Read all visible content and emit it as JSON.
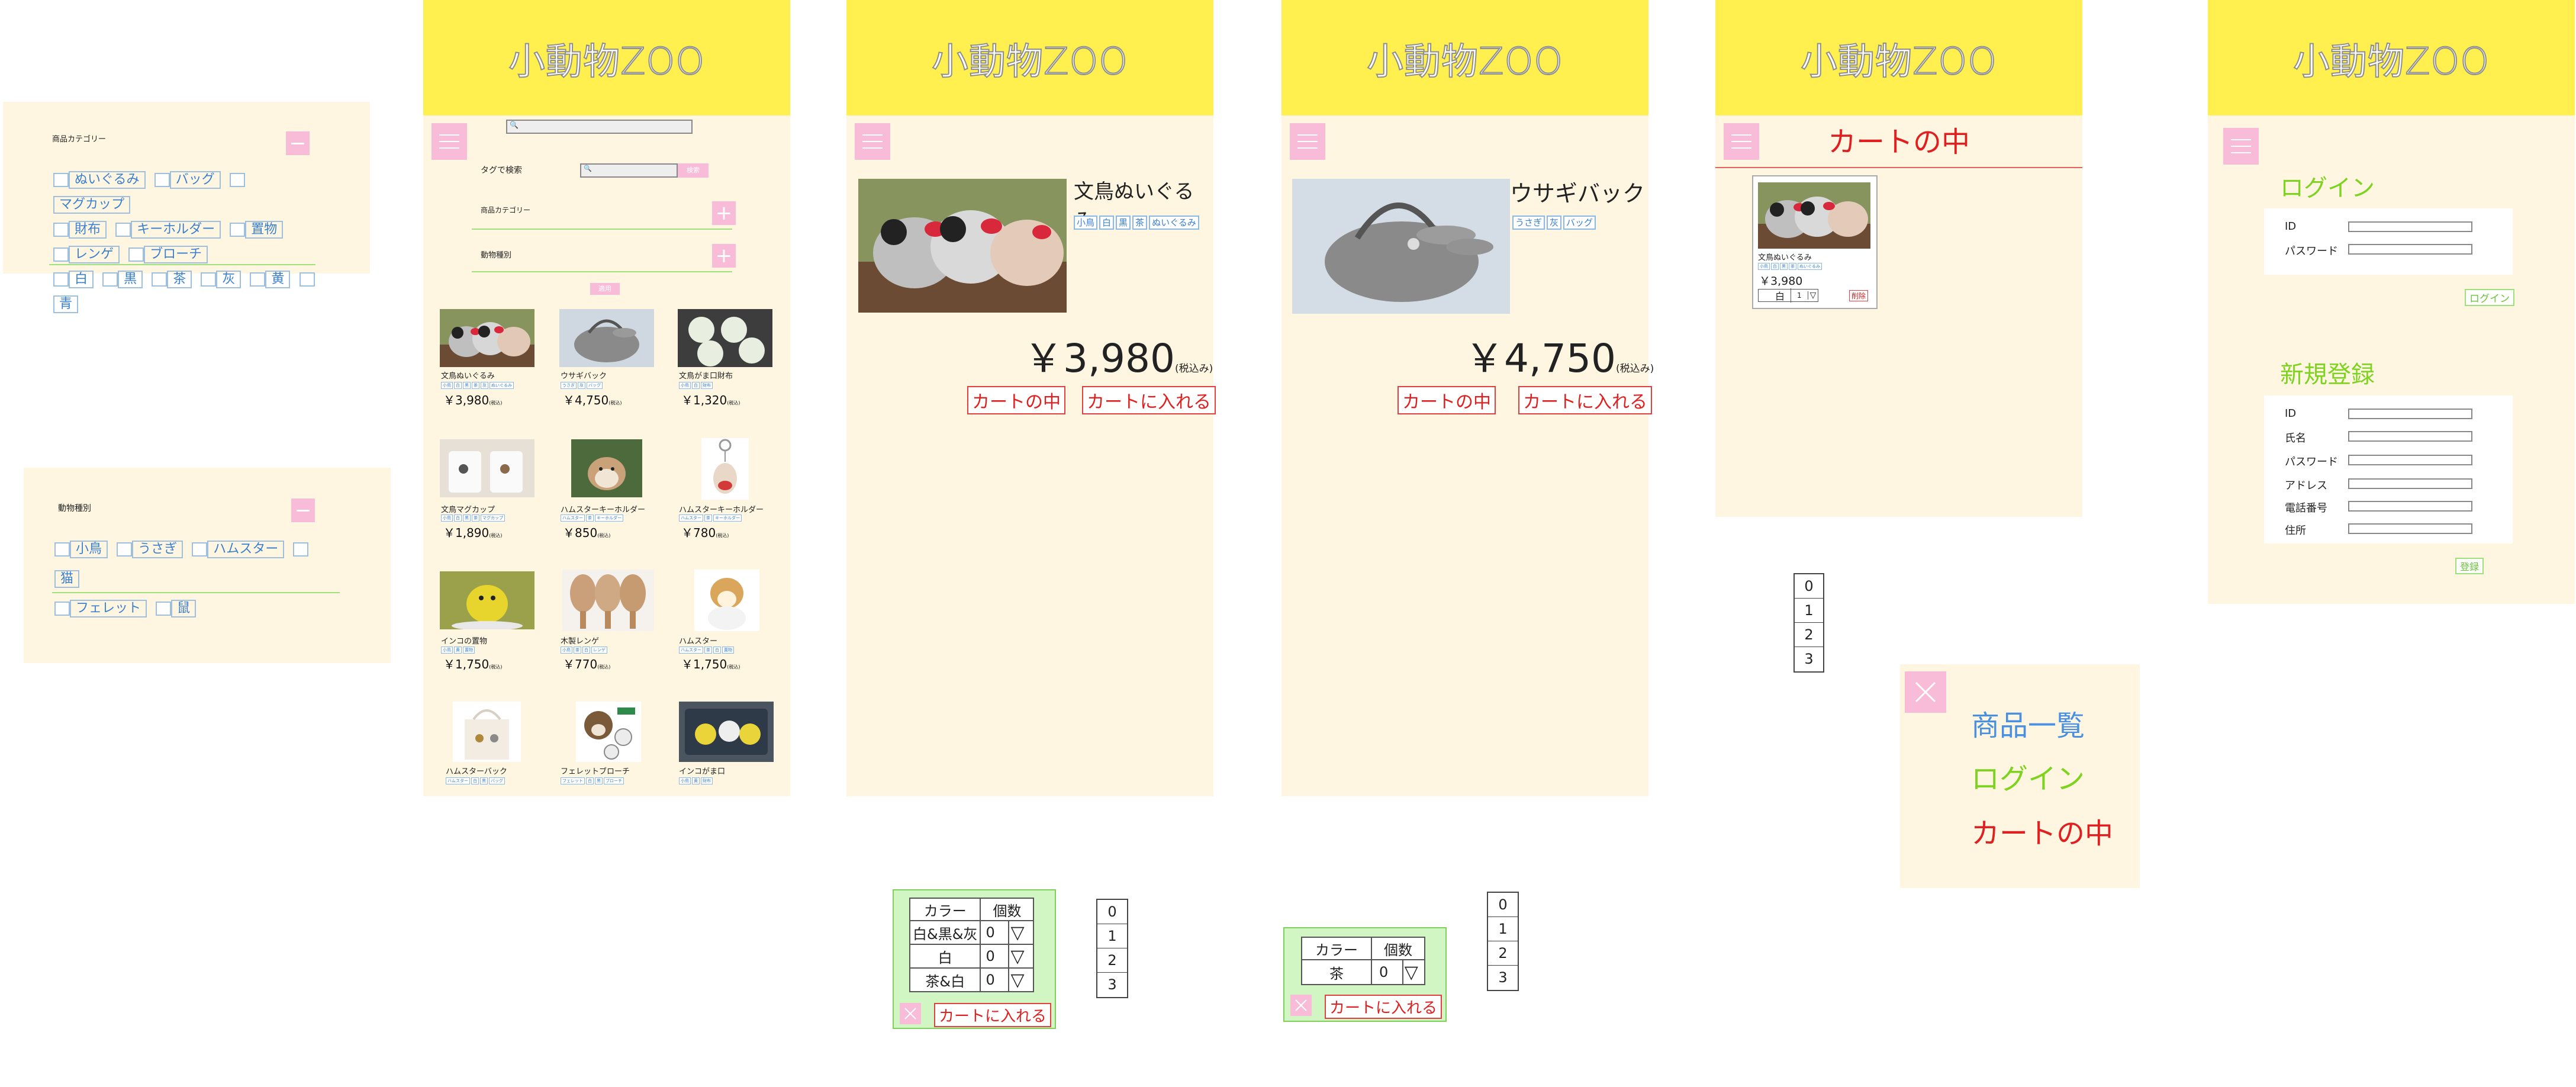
{
  "site_title": "小動物ZOO",
  "panels": {
    "category_popup": {
      "title": "商品カテゴリー",
      "items": [
        "ぬいぐるみ",
        "バッグ",
        "マグカップ",
        "財布",
        "キーホルダー",
        "置物",
        "レンゲ",
        "ブローチ"
      ],
      "colors": [
        "白",
        "黒",
        "茶",
        "灰",
        "黄",
        "青"
      ]
    },
    "animal_popup": {
      "title": "動物種別",
      "items": [
        "小鳥",
        "うさぎ",
        "ハムスター",
        "猫",
        "フェレット",
        "鼠"
      ]
    },
    "list_page": {
      "tag_search_label": "タグで検索",
      "search_button": "検索",
      "category_label": "商品カテゴリー",
      "animal_label": "動物種別",
      "apply_button": "適用",
      "tax_label": "(税込)",
      "products": [
        {
          "name": "文鳥ぬいぐるみ",
          "price": "￥3,980",
          "tags": [
            "小鳥",
            "白",
            "黒",
            "茶",
            "灰",
            "ぬいぐるみ"
          ]
        },
        {
          "name": "ウサギバック",
          "price": "￥4,750",
          "tags": [
            "うさぎ",
            "灰",
            "バッグ"
          ]
        },
        {
          "name": "文鳥がま口財布",
          "price": "￥1,320",
          "tags": [
            "小鳥",
            "白",
            "財布"
          ]
        },
        {
          "name": "文鳥マグカップ",
          "price": "￥1,890",
          "tags": [
            "小鳥",
            "白",
            "黒",
            "茶",
            "マグカップ"
          ]
        },
        {
          "name": "ハムスターキーホルダー",
          "price": "￥850",
          "tags": [
            "ハムスター",
            "茶",
            "キーホルダー"
          ]
        },
        {
          "name": "ハムスターキーホルダー",
          "price": "￥780",
          "tags": [
            "ハムスター",
            "茶",
            "キーホルダー"
          ]
        },
        {
          "name": "インコの置物",
          "price": "￥1,750",
          "tags": [
            "小鳥",
            "黄",
            "置物"
          ]
        },
        {
          "name": "木製レンゲ",
          "price": "￥770",
          "tags": [
            "小鳥",
            "茶",
            "白",
            "レンゲ"
          ]
        },
        {
          "name": "ハムスター",
          "price": "￥1,750",
          "tags": [
            "ハムスター",
            "茶",
            "白",
            "置物"
          ]
        },
        {
          "name": "ハムスターバック",
          "price": "",
          "tags": [
            "ハムスター",
            "白",
            "黒",
            "バッグ"
          ]
        },
        {
          "name": "フェレットブローチ",
          "price": "",
          "tags": [
            "フェレット",
            "白",
            "黒",
            "ブローチ"
          ]
        },
        {
          "name": "インコがま口",
          "price": "",
          "tags": [
            "小鳥",
            "黄",
            "財布"
          ]
        }
      ]
    },
    "detail1": {
      "name": "文鳥ぬいぐるみ",
      "tags": [
        "小鳥",
        "白",
        "黒",
        "茶",
        "ぬいぐるみ"
      ],
      "price": "￥3,980",
      "tax": "(税込み)",
      "cart_view": "カートの中",
      "add_to_cart": "カートに入れる"
    },
    "detail2": {
      "name": "ウサギバック",
      "tags": [
        "うさぎ",
        "灰",
        "バッグ"
      ],
      "price": "￥4,750",
      "tax": "(税込み)",
      "cart_view": "カートの中",
      "add_to_cart": "カートに入れる"
    },
    "cart": {
      "title": "カートの中",
      "item_name": "文鳥ぬいぐるみ",
      "item_tags": [
        "小鳥",
        "白",
        "黒",
        "茶",
        "ぬいぐるみ"
      ],
      "item_price": "￥3,980",
      "color": "白",
      "qty": "1",
      "delete": "削除"
    },
    "login": {
      "login_title": "ログイン",
      "id_label": "ID",
      "password_label": "パスワード",
      "login_button": "ログイン",
      "register_title": "新規登録",
      "register_fields": [
        "ID",
        "氏名",
        "パスワード",
        "アドレス",
        "電話番号",
        "住所"
      ],
      "register_button": "登録"
    },
    "menu_popup": {
      "items": [
        "商品一覧",
        "ログイン",
        "カートの中"
      ],
      "colors": [
        "#4a90e2",
        "#7ed321",
        "#e02020"
      ]
    },
    "qty_list_cart": [
      "0",
      "1",
      "2",
      "3"
    ],
    "color_popup1": {
      "headers": [
        "カラー",
        "個数"
      ],
      "rows": [
        {
          "color": "白&黒&灰",
          "qty": "0"
        },
        {
          "color": "白",
          "qty": "0"
        },
        {
          "color": "茶&白",
          "qty": "0"
        }
      ],
      "add_button": "カートに入れる"
    },
    "qty_list1": [
      "0",
      "1",
      "2",
      "3"
    ],
    "color_popup2": {
      "headers": [
        "カラー",
        "個数"
      ],
      "rows": [
        {
          "color": "茶",
          "qty": "0"
        }
      ],
      "add_button": "カートに入れる"
    },
    "qty_list2": [
      "0",
      "1",
      "2",
      "3"
    ]
  }
}
